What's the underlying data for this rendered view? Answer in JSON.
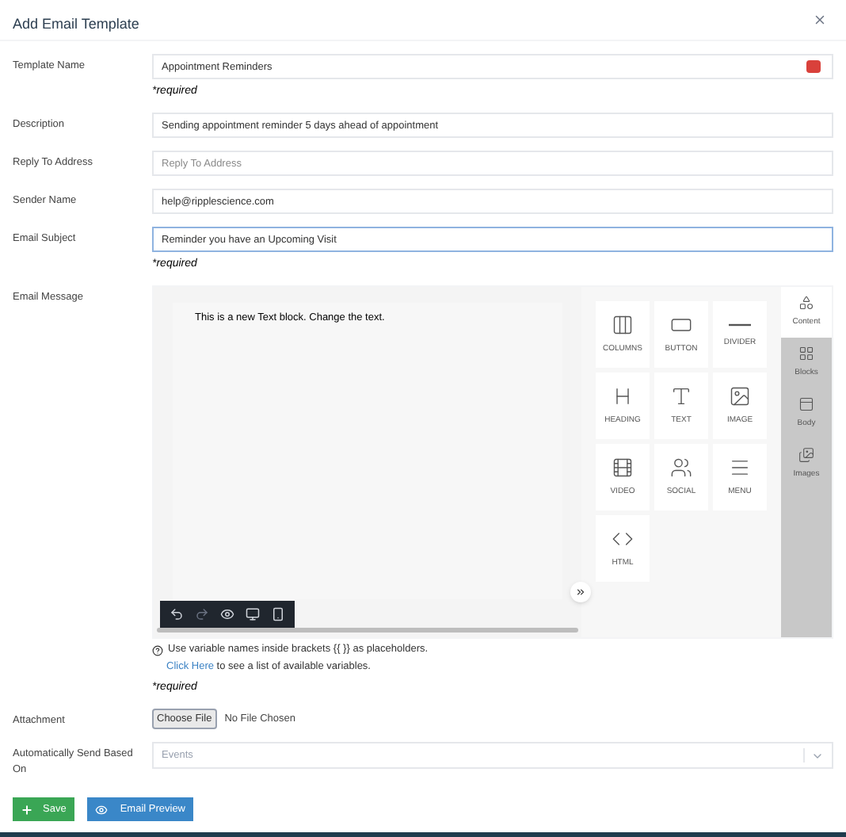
{
  "dialog": {
    "title": "Add Email Template"
  },
  "fields": [
    {
      "label": "Template Name",
      "kind": "input",
      "value": "Appointment Reminders",
      "required": "*required",
      "focused": false,
      "badge": true
    },
    {
      "label": "Description",
      "kind": "input",
      "value": "Sending appointment reminder 5 days ahead of appointment",
      "focused": false
    },
    {
      "label": "Reply To Address",
      "kind": "input",
      "placeholder": "Reply To Address",
      "focused": false
    },
    {
      "label": "Sender Name",
      "kind": "input",
      "value": "help@ripplescience.com",
      "focused": false
    },
    {
      "label": "Email Subject",
      "kind": "input",
      "value": "Reminder you have an Upcoming Visit",
      "required": "*required",
      "focused": true
    },
    {
      "label": "Email Message",
      "kind": "editor",
      "required": "*required"
    },
    {
      "label": "Attachment",
      "kind": "file",
      "button": "Choose File",
      "value": "No File Chosen"
    },
    {
      "label": "Automatically Send Based On",
      "kind": "select",
      "placeholder": "Events"
    }
  ],
  "editor": {
    "canvas_text": "This is a new Text block. Change the text.",
    "tiles": [
      {
        "label": "COLUMNS",
        "kind": "columns"
      },
      {
        "label": "BUTTON",
        "kind": "button"
      },
      {
        "label": "DIVIDER",
        "kind": "divider"
      },
      {
        "label": "HEADING",
        "kind": "heading"
      },
      {
        "label": "TEXT",
        "kind": "text"
      },
      {
        "label": "IMAGE",
        "kind": "image"
      },
      {
        "label": "VIDEO",
        "kind": "video"
      },
      {
        "label": "SOCIAL",
        "kind": "social"
      },
      {
        "label": "MENU",
        "kind": "menu"
      },
      {
        "label": "HTML",
        "kind": "html"
      }
    ],
    "tabs": [
      {
        "label": "Content",
        "kind": "content",
        "selected": true
      },
      {
        "label": "Blocks",
        "kind": "blocks",
        "selected": false
      },
      {
        "label": "Body",
        "kind": "body",
        "selected": false
      },
      {
        "label": "Images",
        "kind": "images",
        "selected": false
      }
    ],
    "help": "Use variable names inside brackets {{ }} as placeholders.",
    "link": "Click Here",
    "link_rest": "to see a list of available variables."
  },
  "buttons": [
    {
      "label": "Save",
      "kind": "save"
    },
    {
      "label": "Email Preview",
      "kind": "preview"
    }
  ]
}
